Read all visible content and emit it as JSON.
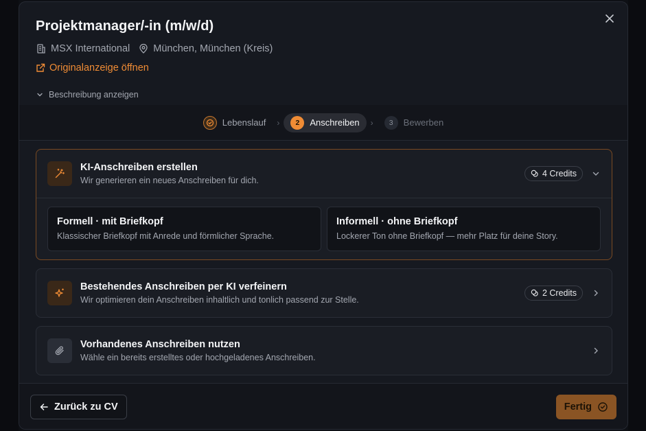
{
  "job": {
    "title": "Projektmanager/-in (m/w/d)",
    "company": "MSX International",
    "location": "München, München (Kreis)",
    "original_link": "Originalanzeige öffnen",
    "description_toggle": "Beschreibung anzeigen"
  },
  "stepper": {
    "steps": [
      {
        "num": "",
        "label": "Lebenslauf",
        "state": "done"
      },
      {
        "num": "2",
        "label": "Anschreiben",
        "state": "active"
      },
      {
        "num": "3",
        "label": "Bewerben",
        "state": "todo"
      }
    ]
  },
  "cards": {
    "generate": {
      "title": "KI-Anschreiben erstellen",
      "subtitle": "Wir generieren ein neues Anschreiben für dich.",
      "credits": "4 Credits",
      "options": [
        {
          "title": "Formell · mit Briefkopf",
          "desc": "Klassischer Briefkopf mit Anrede und förmlicher Sprache."
        },
        {
          "title": "Informell · ohne Briefkopf",
          "desc": "Lockerer Ton ohne Briefkopf — mehr Platz für deine Story."
        }
      ]
    },
    "refine": {
      "title": "Bestehendes Anschreiben per KI verfeinern",
      "subtitle": "Wir optimieren dein Anschreiben inhaltlich und tonlich passend zur Stelle.",
      "credits": "2 Credits"
    },
    "existing": {
      "title": "Vorhandenes Anschreiben nutzen",
      "subtitle": "Wähle ein bereits erstelltes oder hochgeladenes Anschreiben."
    }
  },
  "footer": {
    "back_label": "Zurück zu CV",
    "done_label": "Fertig"
  },
  "colors": {
    "accent": "#f08c35",
    "background": "#161920",
    "done_button": "#8a5424"
  },
  "icons": {
    "close": "close-icon",
    "company": "building-icon",
    "location": "map-pin-icon",
    "external": "external-link-icon",
    "wand": "magic-wand-icon",
    "sparkles": "sparkles-icon",
    "paperclip": "paperclip-icon",
    "coins": "coins-icon",
    "arrow_left": "arrow-left-icon",
    "check_circle": "check-circle-icon"
  }
}
